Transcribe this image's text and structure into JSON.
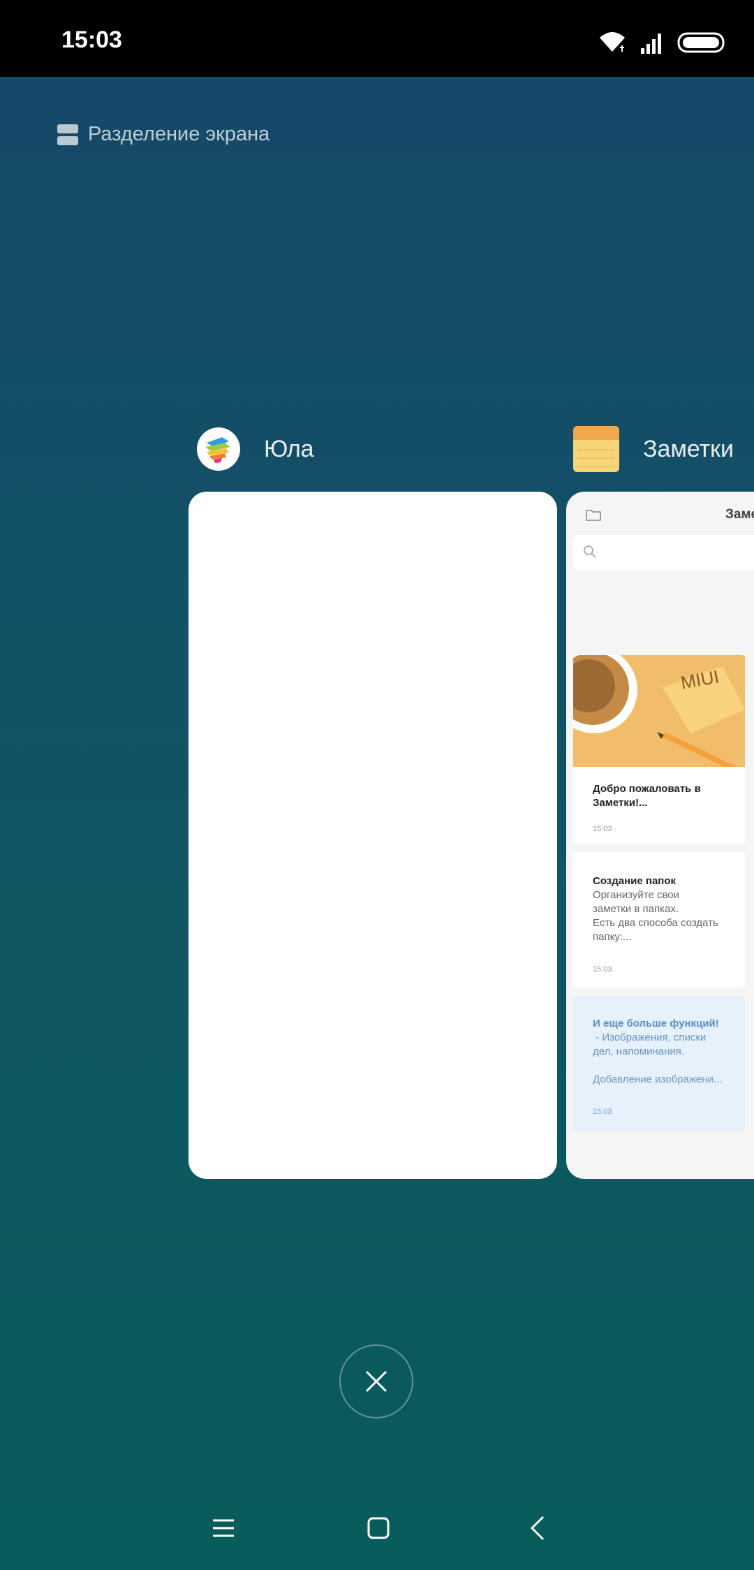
{
  "status_bar": {
    "time": "15:03",
    "icons": [
      "wifi-icon",
      "signal-icon",
      "battery-icon"
    ]
  },
  "recents": {
    "split_screen_label": "Разделение экрана",
    "apps": [
      {
        "name": "Юла",
        "icon": "yula-app-icon"
      },
      {
        "name": "Заметки",
        "icon": "notes-app-icon",
        "preview": {
          "header_title": "Заме",
          "notes": [
            {
              "image_text": "MIUI",
              "title": "Добро пожаловать в Заметки!...",
              "time": "15:03"
            },
            {
              "title": "Создание папок",
              "body_lines": [
                "Организуйте свои",
                "заметки в папках.",
                "Есть два способа создать",
                "папку:..."
              ],
              "time": "15:03"
            },
            {
              "title": "И еще больше функций!",
              "body_lines": [
                " - Изображения, списки",
                "дел, напоминания.",
                "",
                "Добавление изображени..."
              ],
              "time": "15:03"
            }
          ]
        }
      }
    ],
    "close_all_icon": "close-icon"
  },
  "nav_bar": {
    "buttons": [
      "menu-icon",
      "home-icon",
      "back-icon"
    ]
  },
  "colors": {
    "gradient_top": "#164869",
    "gradient_bottom": "#085c5a",
    "note_highlight": "#6a96c8"
  }
}
